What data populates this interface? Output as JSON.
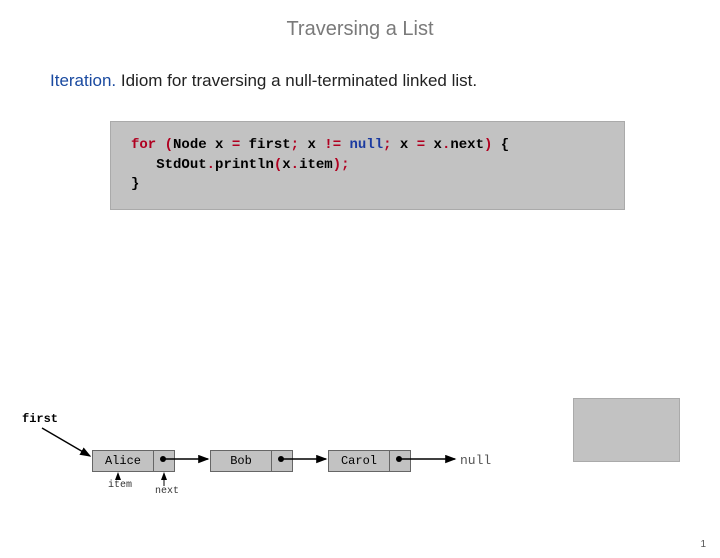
{
  "title": "Traversing a List",
  "subtitle": {
    "lead": "Iteration.",
    "rest": "  Idiom for traversing a null-terminated linked list."
  },
  "code": {
    "for": "for",
    "lp1": " (",
    "node": "Node x ",
    "eq1": "=",
    "first": " first",
    "sc1": ";",
    "xne": " x ",
    "ne": "!=",
    "sp1": " ",
    "null": "null",
    "sc2": ";",
    "xeq": " x ",
    "eq2": "=",
    "xn": " x",
    "dot1": ".",
    "next": "next",
    "rp1": ")",
    "brace": " {",
    "ind": "   ",
    "stdout": "StdOut",
    "dot2": ".",
    "println": "println",
    "lp2": "(",
    "x2": "x",
    "dot3": ".",
    "item": "item",
    "rp2": ");",
    "close": "}"
  },
  "diagram": {
    "firstLabel": "first",
    "nodes": [
      "Alice",
      "Bob",
      "Carol"
    ],
    "nullLabel": "null",
    "itemLabel": "item",
    "nextLabel": "next"
  },
  "pageNumber": "1"
}
